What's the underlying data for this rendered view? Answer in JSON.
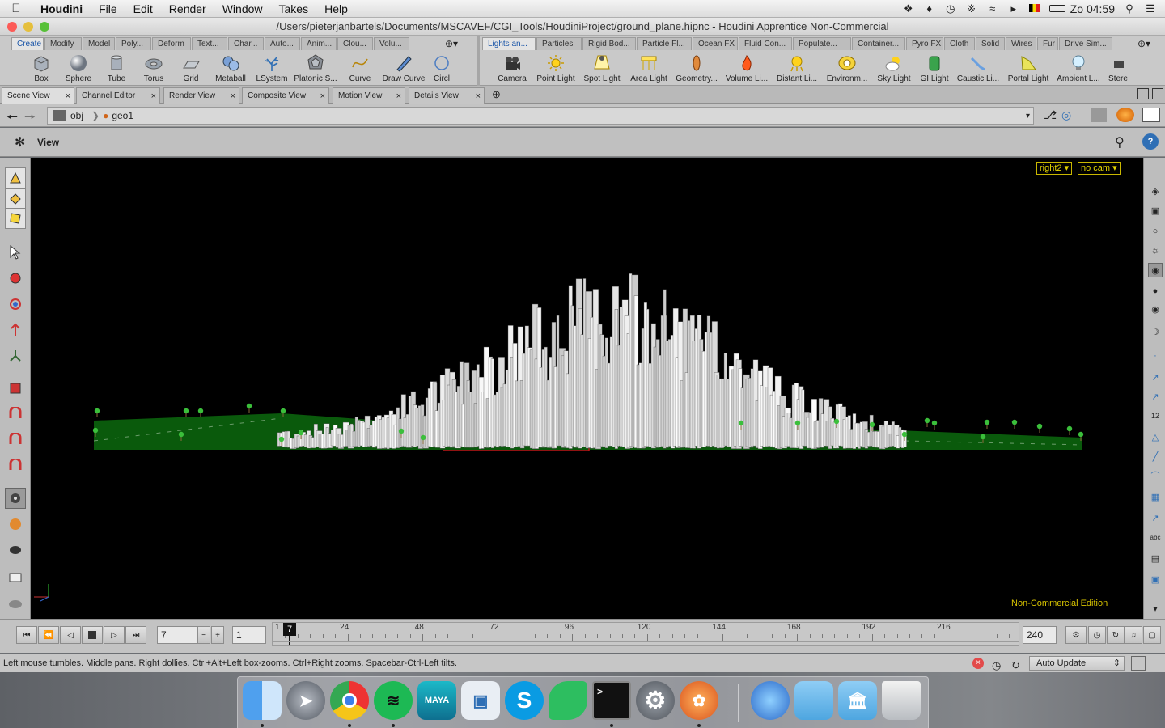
{
  "menubar": {
    "app": "Houdini",
    "items": [
      "File",
      "Edit",
      "Render",
      "Window",
      "Takes",
      "Help"
    ],
    "clock": "Zo 04:59"
  },
  "window": {
    "title": "/Users/pieterjanbartels/Documents/MSCAVEF/CGI_Tools/HoudiniProject/ground_plane.hipnc - Houdini Apprentice Non-Commercial"
  },
  "shelf_left": {
    "tabs": [
      "Create",
      "Modify",
      "Model",
      "Poly...",
      "Deform",
      "Text...",
      "Char...",
      "Auto...",
      "Anim...",
      "Clou...",
      "Volu..."
    ],
    "tools": [
      "Box",
      "Sphere",
      "Tube",
      "Torus",
      "Grid",
      "Metaball",
      "LSystem",
      "Platonic S...",
      "Curve",
      "Draw Curve",
      "Circl"
    ]
  },
  "shelf_right": {
    "tabs": [
      "Lights an...",
      "Particles",
      "Rigid Bod...",
      "Particle Fl...",
      "Ocean FX",
      "Fluid Con...",
      "Populate...",
      "Container...",
      "Pyro FX",
      "Cloth",
      "Solid",
      "Wires",
      "Fur",
      "Drive Sim..."
    ],
    "tools": [
      "Camera",
      "Point Light",
      "Spot Light",
      "Area Light",
      "Geometry...",
      "Volume Li...",
      "Distant Li...",
      "Environm...",
      "Sky Light",
      "GI Light",
      "Caustic Li...",
      "Portal Light",
      "Ambient L...",
      "Stere"
    ]
  },
  "pane_tabs": [
    "Scene View",
    "Channel Editor",
    "Render View",
    "Composite View",
    "Motion View",
    "Details View"
  ],
  "path": {
    "root": "obj",
    "node": "geo1"
  },
  "view": {
    "label": "View",
    "camera_menu": "right2",
    "cam_menu": "no cam",
    "watermark": "Non-Commercial Edition"
  },
  "timeline": {
    "current_frame": "7",
    "step": "1",
    "end_frame": "240",
    "ruler_start": "1",
    "ticks": [
      "24",
      "48",
      "72",
      "96",
      "120",
      "144",
      "168",
      "192",
      "216"
    ],
    "playhead": "7"
  },
  "status": {
    "message": "Left mouse tumbles. Middle pans. Right dollies. Ctrl+Alt+Left box-zooms. Ctrl+Right zooms. Spacebar-Ctrl-Left tilts.",
    "update_mode": "Auto Update"
  },
  "colors": {
    "ground": "#0a5a0c",
    "viewport_bg": "#000000",
    "accent": "#e2d200",
    "active_tab": "#1a55a8"
  },
  "dock": [
    "Finder",
    "Launchpad",
    "Chrome",
    "Spotify",
    "Maya",
    "Preview",
    "Skype",
    "Evernote",
    "Terminal",
    "System Preferences",
    "Houdini",
    "Chrome Canary",
    "Folder",
    "Applications",
    "Trash"
  ]
}
